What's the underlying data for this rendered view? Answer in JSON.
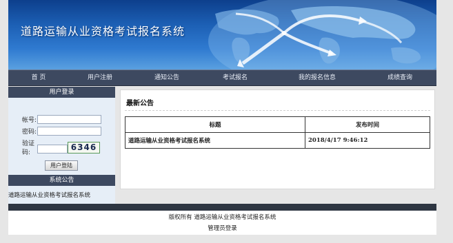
{
  "banner": {
    "title": "道路运输从业资格考试报名系统"
  },
  "nav": {
    "items": [
      "首  页",
      "用户注册",
      "通知公告",
      "考试报名",
      "我的报名信息",
      "成绩查询"
    ]
  },
  "login": {
    "header": "用户登录",
    "account_label": "帐号:",
    "password_label": "密码:",
    "captcha_label": "验证码:",
    "captcha_code": "6346",
    "submit_label": "用户登陆"
  },
  "system_notice": {
    "header": "系统公告",
    "text": "道路运输从业资格考试报名系统"
  },
  "latest": {
    "title": "最新公告",
    "columns": [
      "标题",
      "发布时间"
    ],
    "rows": [
      {
        "title": "道路运输从业资格考试报名系统",
        "time": "2018/4/17 9:46:12"
      }
    ]
  },
  "footer": {
    "copyright": "版权所有 道路运输从业资格考试报名系统",
    "admin_login": "管理员登录"
  }
}
